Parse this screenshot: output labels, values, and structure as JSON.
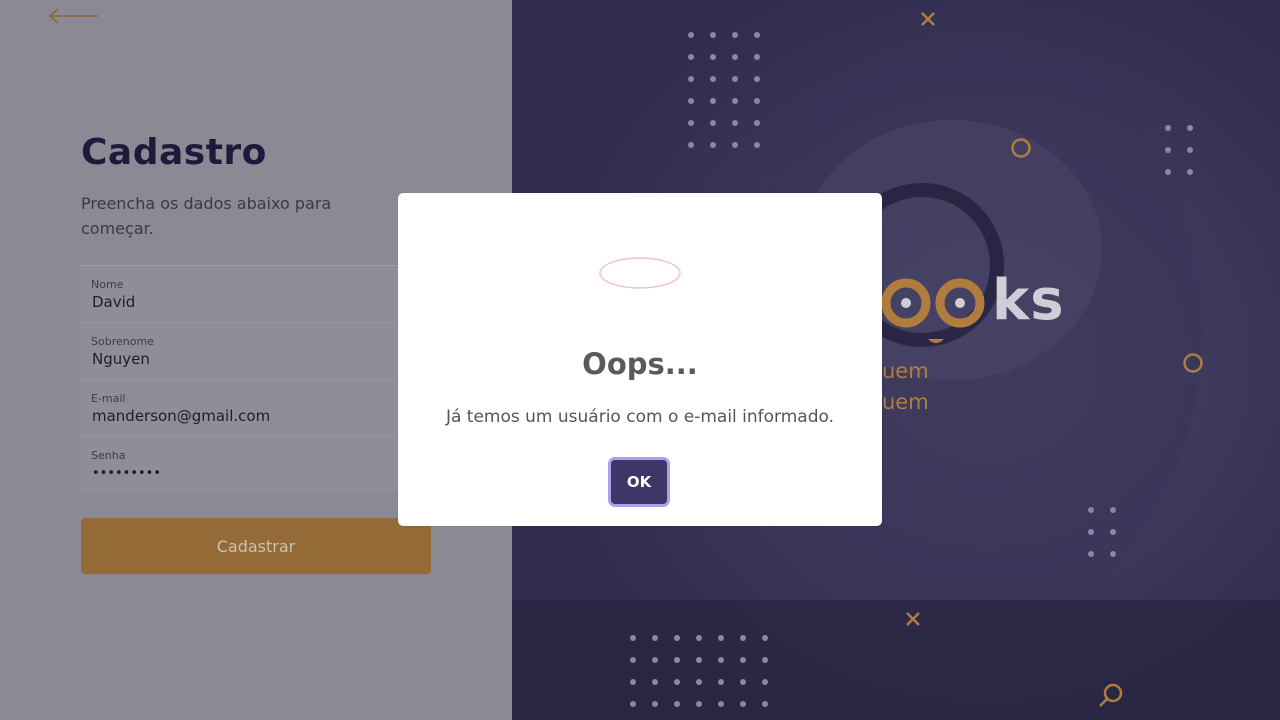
{
  "form": {
    "title": "Cadastro",
    "subtitle": "Preencha os dados abaixo para começar.",
    "fields": [
      {
        "label": "Nome",
        "value": "David"
      },
      {
        "label": "Sobrenome",
        "value": "Nguyen"
      },
      {
        "label": "E-mail",
        "value": "manderson@gmail.com"
      },
      {
        "label": "Senha",
        "value": "•••••••••"
      }
    ],
    "submit_label": "Cadastrar"
  },
  "brand": {
    "text": "ks",
    "tagline_1": "uem",
    "tagline_2": "uem"
  },
  "modal": {
    "title": "Oops...",
    "message": "Já temos um usuário com o e-mail informado.",
    "ok_label": "OK"
  },
  "colors": {
    "accent": "#946a37",
    "brand_purple": "#3d3768"
  }
}
